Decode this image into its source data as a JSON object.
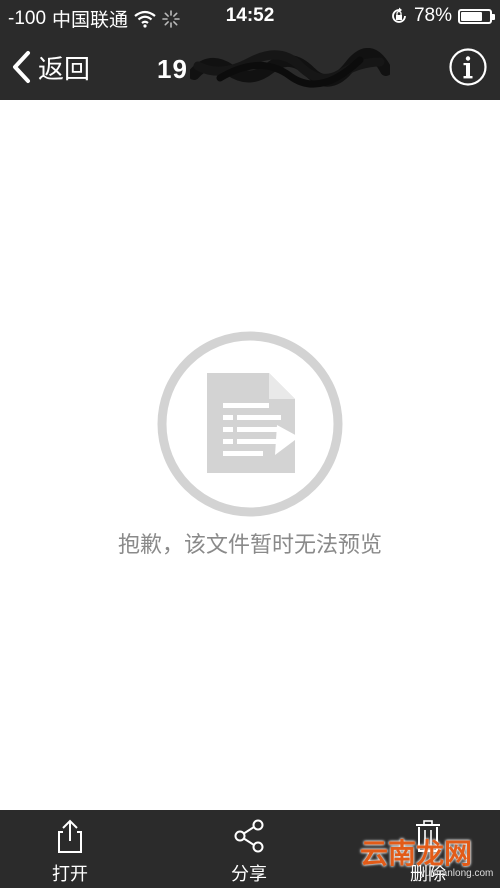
{
  "status_bar": {
    "carrier_signal": "-100",
    "carrier": "中国联通",
    "time": "14:52",
    "battery_percent": "78%",
    "battery_level": 0.78,
    "icons": [
      "wifi-icon",
      "activity-spinner-icon",
      "rotation-lock-icon",
      "battery-icon"
    ]
  },
  "nav": {
    "back_label": "返回",
    "title": "19",
    "info_icon": "info-icon"
  },
  "content": {
    "icon": "document-unavailable-icon",
    "message": "抱歉，该文件暂时无法预览"
  },
  "toolbar": {
    "items": [
      {
        "label": "打开",
        "icon": "share-export-icon"
      },
      {
        "label": "分享",
        "icon": "share-nodes-icon"
      },
      {
        "label": "删除",
        "icon": "trash-icon"
      }
    ]
  },
  "watermark": {
    "text": "云南龙网",
    "sub": "yunnanlong.com"
  },
  "colors": {
    "bar_background": "#2b2b2b",
    "icon_gray": "#d3d3d3",
    "message_gray": "#8a8a8a",
    "watermark_orange": "#e25b18"
  }
}
